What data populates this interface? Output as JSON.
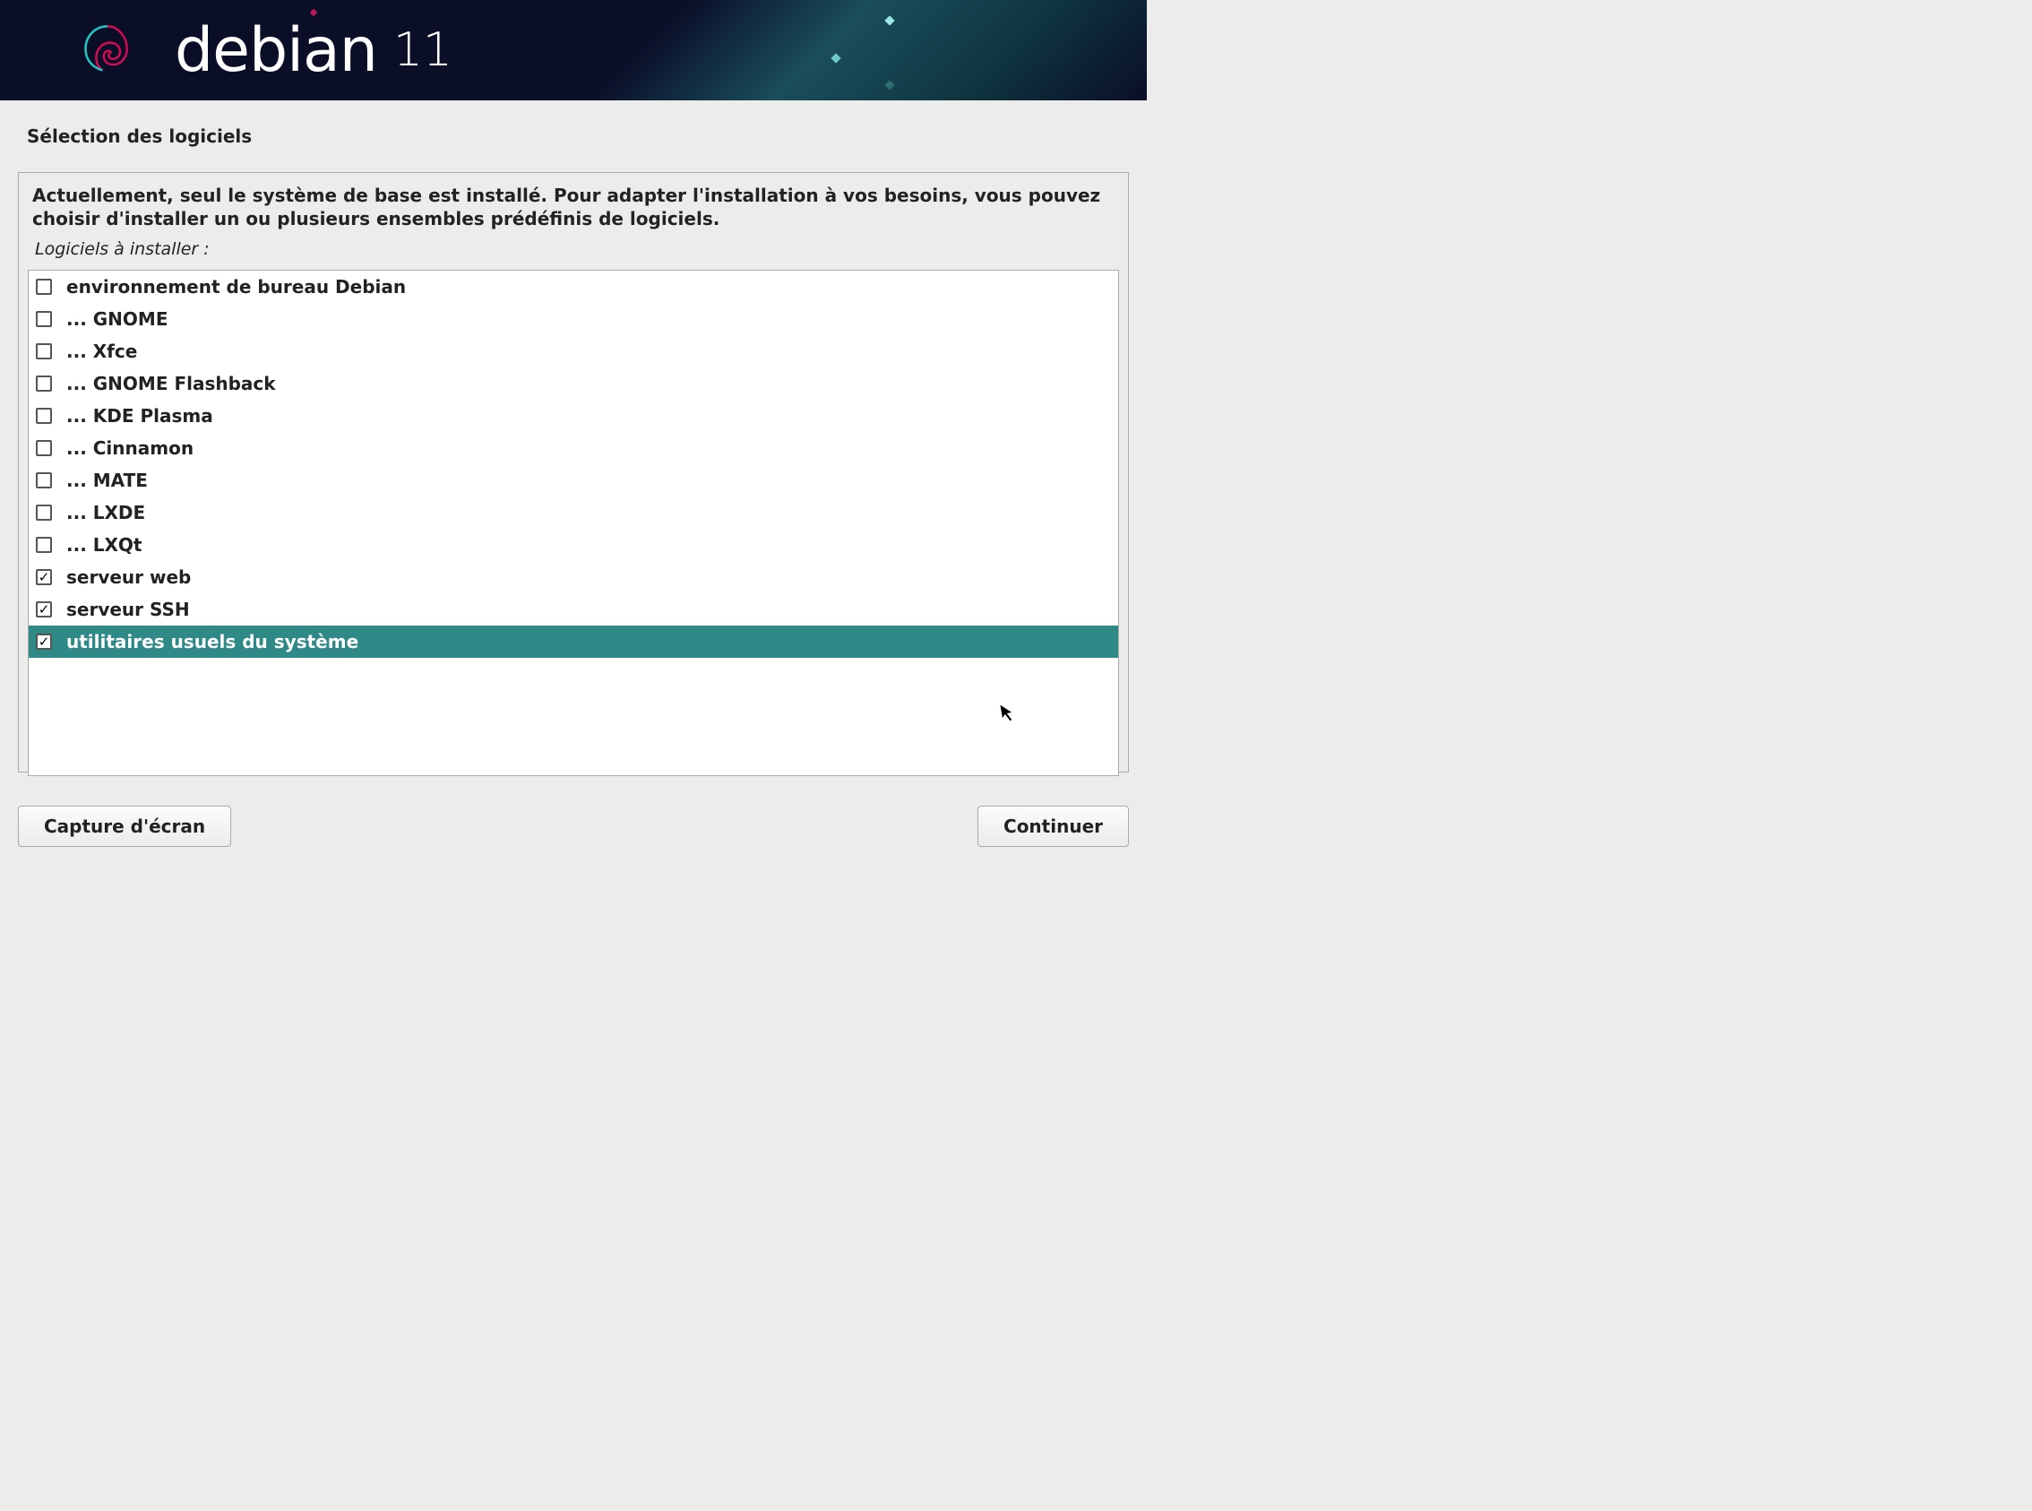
{
  "header": {
    "brand": "debian",
    "version": "11"
  },
  "page": {
    "title": "Sélection des logiciels",
    "description": "Actuellement, seul le système de base est installé. Pour adapter l'installation à vos besoins, vous pouvez choisir d'installer un ou plusieurs ensembles prédéfinis de logiciels.",
    "subtitle": "Logiciels à installer :"
  },
  "software": {
    "items": [
      {
        "label": "environnement de bureau Debian",
        "checked": false,
        "selected": false
      },
      {
        "label": "... GNOME",
        "checked": false,
        "selected": false
      },
      {
        "label": "... Xfce",
        "checked": false,
        "selected": false
      },
      {
        "label": "... GNOME Flashback",
        "checked": false,
        "selected": false
      },
      {
        "label": "... KDE Plasma",
        "checked": false,
        "selected": false
      },
      {
        "label": "... Cinnamon",
        "checked": false,
        "selected": false
      },
      {
        "label": "... MATE",
        "checked": false,
        "selected": false
      },
      {
        "label": "... LXDE",
        "checked": false,
        "selected": false
      },
      {
        "label": "... LXQt",
        "checked": false,
        "selected": false
      },
      {
        "label": "serveur web",
        "checked": true,
        "selected": false
      },
      {
        "label": "serveur SSH",
        "checked": true,
        "selected": false
      },
      {
        "label": "utilitaires usuels du système",
        "checked": true,
        "selected": true
      }
    ]
  },
  "buttons": {
    "screenshot": "Capture d'écran",
    "continue": "Continuer"
  }
}
